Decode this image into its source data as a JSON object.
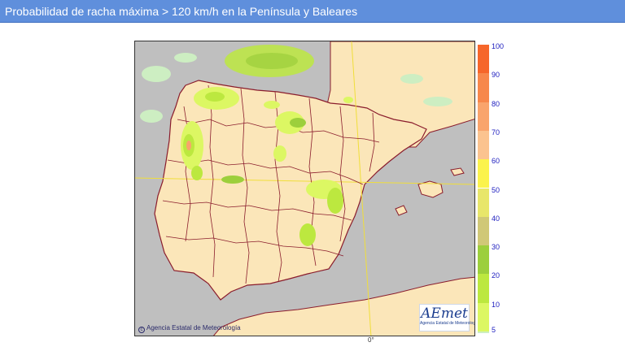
{
  "header": {
    "title": "Probabilidad de racha máxima > 120 km/h en la Península y Baleares"
  },
  "map": {
    "credit": "Agencia Estatal de Meteorología",
    "credit_icon": "copyright-icon",
    "longitude_label": "0°",
    "colors": {
      "land": "#fbe6b9",
      "sea": "#bfbfbf",
      "borders": "#8a1c2c",
      "grid": "#f0de3a"
    }
  },
  "logo": {
    "word": "AEmet",
    "subtitle": "Agencia Estatal de Meteorología"
  },
  "legend": {
    "labels": [
      "100",
      "90",
      "80",
      "70",
      "60",
      "50",
      "40",
      "30",
      "20",
      "10",
      "5"
    ],
    "colors": [
      "#f6662a",
      "#f7874b",
      "#f9a46c",
      "#fbc38f",
      "#fbf34c",
      "#e8e66a",
      "#d0c877",
      "#9ccf3c",
      "#bce83f",
      "#dcf763",
      "#cdeec2"
    ]
  }
}
